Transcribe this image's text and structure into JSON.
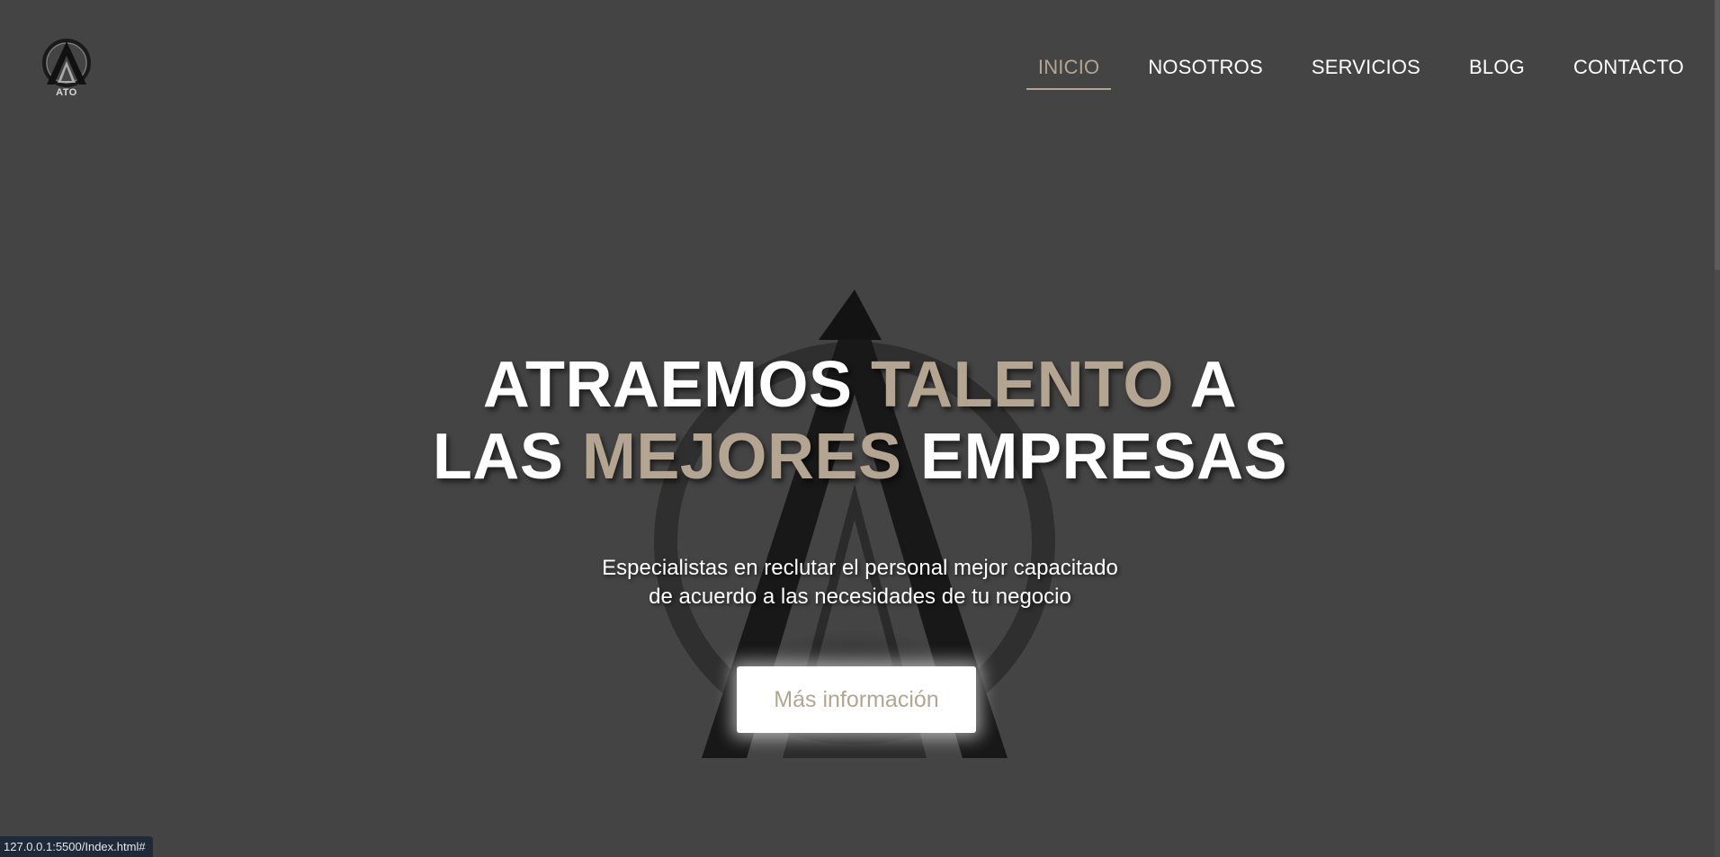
{
  "logo": {
    "text": "ATO",
    "icon": "ato-logo-icon"
  },
  "nav": {
    "items": [
      {
        "label": "INICIO",
        "active": true
      },
      {
        "label": "NOSOTROS",
        "active": false
      },
      {
        "label": "SERVICIOS",
        "active": false
      },
      {
        "label": "BLOG",
        "active": false
      },
      {
        "label": "CONTACTO",
        "active": false
      }
    ]
  },
  "hero": {
    "title_line1_a": "ATRAEMOS",
    "title_line1_b": "TALENTO",
    "title_line1_c": "A",
    "title_line2_a": "LAS",
    "title_line2_b": "MEJORES",
    "title_line2_c": "EMPRESAS",
    "subtitle_line1": "Especialistas en reclutar el personal mejor capacitado",
    "subtitle_line2": "de acuerdo a las necesidades de tu negocio",
    "cta_label": "Más información"
  },
  "status_bar": {
    "url": "127.0.0.1:5500/Index.html#"
  },
  "colors": {
    "background": "#444444",
    "accent": "#b3a591",
    "text": "#ffffff"
  }
}
